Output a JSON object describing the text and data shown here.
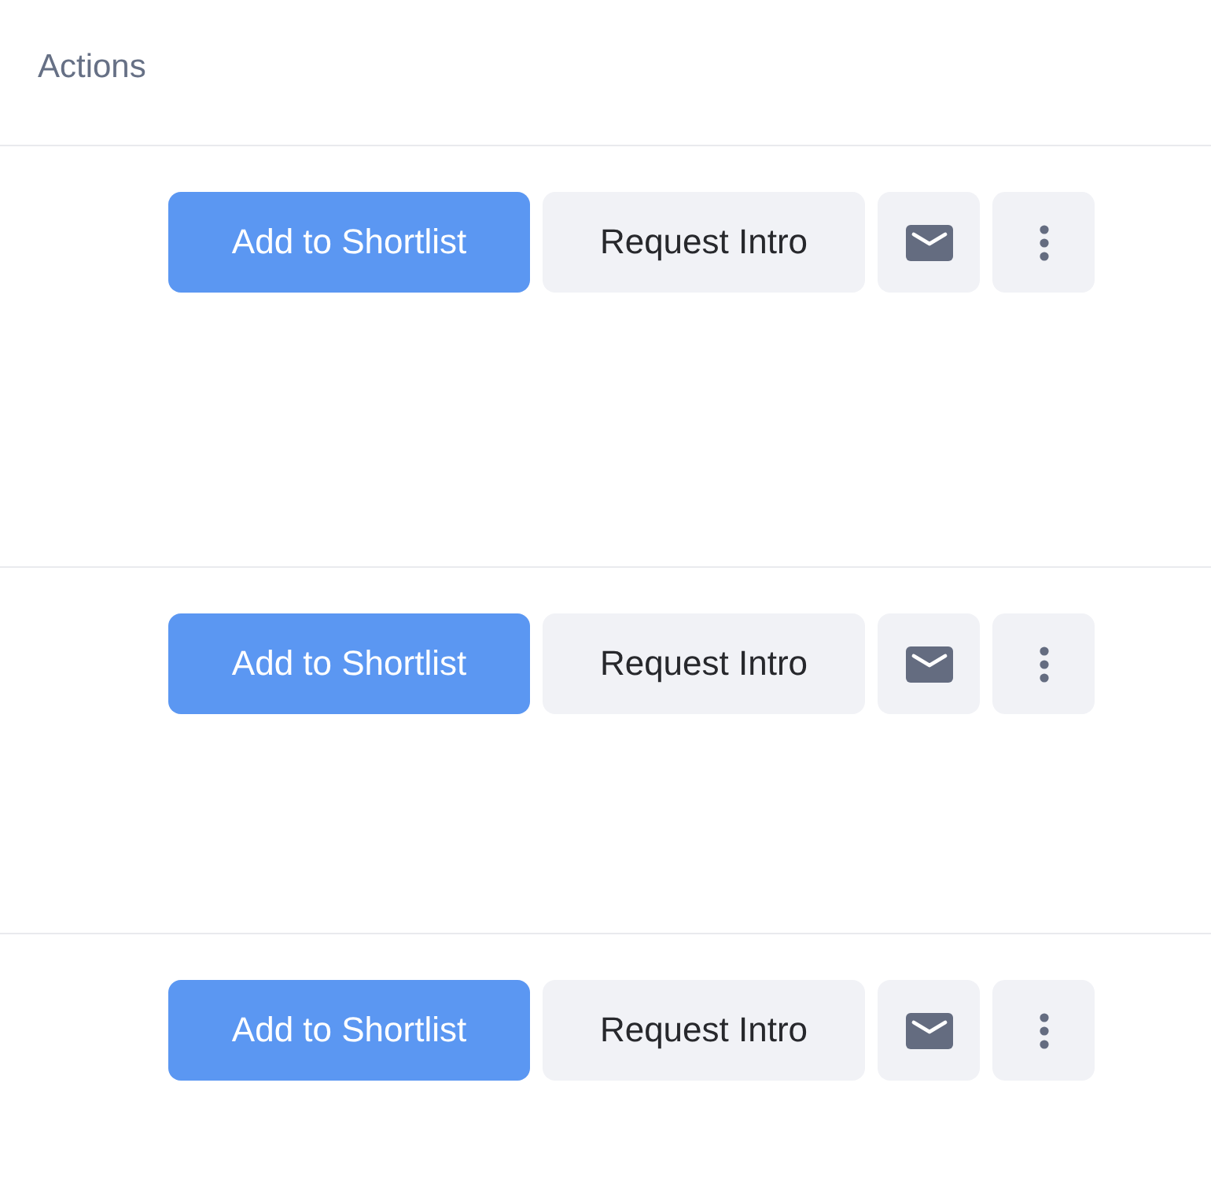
{
  "table": {
    "column_header": "Actions",
    "rows": [
      {
        "buttons": [
          {
            "kind": "primary",
            "label": "Add to Shortlist"
          },
          {
            "kind": "secondary",
            "label": "Request Intro"
          },
          {
            "kind": "mail"
          },
          {
            "kind": "more"
          }
        ]
      },
      {
        "buttons": [
          {
            "kind": "primary",
            "label": "Add to Shortlist"
          },
          {
            "kind": "secondary",
            "label": "Request Intro"
          },
          {
            "kind": "mail"
          },
          {
            "kind": "more"
          }
        ]
      },
      {
        "buttons": [
          {
            "kind": "primary",
            "label": "Add to Shortlist"
          },
          {
            "kind": "secondary",
            "label": "Request Intro"
          },
          {
            "kind": "mail"
          },
          {
            "kind": "more"
          }
        ]
      }
    ]
  }
}
